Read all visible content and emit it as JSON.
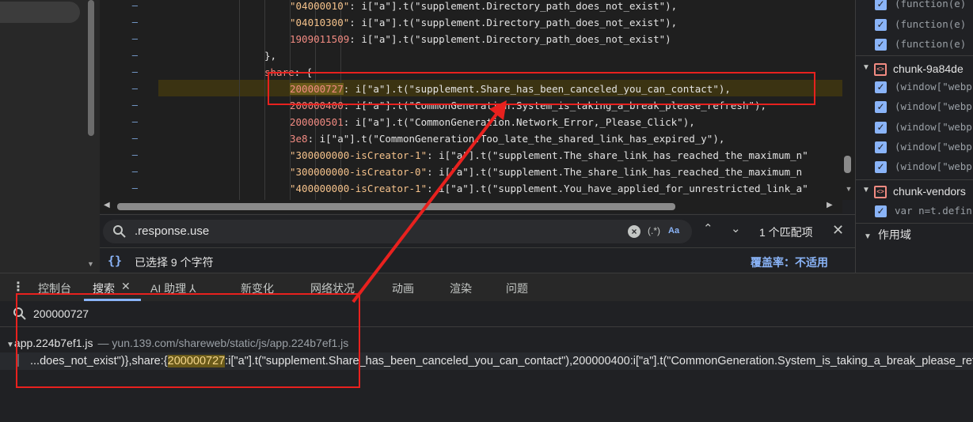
{
  "editor": {
    "lines": [
      {
        "k": "\"04000010\"",
        "v": ": i[\"a\"].t(\"supplement.Directory_path_does_not_exist\"),"
      },
      {
        "k": "\"04010300\"",
        "v": ": i[\"a\"].t(\"supplement.Directory_path_does_not_exist\"),"
      },
      {
        "k": "1909011509",
        "v": ": i[\"a\"].t(\"supplement.Directory_path_does_not_exist\")"
      },
      {
        "k": "",
        "v": "},"
      },
      {
        "k": "share",
        "v": ": {"
      },
      {
        "k": "200000727",
        "v": ": i[\"a\"].t(\"supplement.Share_has_been_canceled_you_can_contact\"),"
      },
      {
        "k": "200000400",
        "v": ": i[\"a\"].t(\"CommonGeneration.System_is_taking_a_break_please_refresh\"),"
      },
      {
        "k": "200000501",
        "v": ": i[\"a\"].t(\"CommonGeneration.Network_Error,_Please_Click\"),"
      },
      {
        "k": "3e8",
        "v": ": i[\"a\"].t(\"CommonGeneration.Too_late_the_shared_link_has_expired_y\"),"
      },
      {
        "k": "\"300000000-isCreator-1\"",
        "v": ": i[\"a\"].t(\"supplement.The_share_link_has_reached_the_maximum_n\""
      },
      {
        "k": "\"300000000-isCreator-0\"",
        "v": ": i[\"a\"].t(\"supplement.The_share_link_has_reached_the_maximum_n"
      },
      {
        "k": "\"400000000-isCreator-1\"",
        "v": ": i[\"a\"].t(\"supplement.You_have_applied_for_unrestricted_link_a\""
      }
    ],
    "gutter_mark": "–"
  },
  "findbar": {
    "query": ".response.use",
    "regex_label": "(.*)",
    "case_label": "Aa",
    "count": "1 个匹配项",
    "up": "⌃",
    "down": "⌄",
    "close": "✕"
  },
  "status": {
    "braces": "{}",
    "selected": "已选择 9 个字符",
    "coverage": "覆盖率：不适用"
  },
  "rightpane": {
    "group1_rows": [
      "(function(e)",
      "(function(e)",
      "(function(e)"
    ],
    "group2_name": "chunk-9a84de",
    "group2_rows": [
      "(window[\"webp",
      "(window[\"webp",
      "(window[\"webp",
      "(window[\"webp",
      "(window[\"webp"
    ],
    "group3_name": "chunk-vendors",
    "group3_rows": [
      "var n=t.defin"
    ],
    "scope": "作用域"
  },
  "drawer": {
    "tabs": [
      {
        "label": "控制台"
      },
      {
        "label": "搜索"
      },
      {
        "label": "AI 助理 ⅄"
      },
      {
        "label": "新变化"
      },
      {
        "label": "网络状况"
      },
      {
        "label": "动画"
      },
      {
        "label": "渲染"
      },
      {
        "label": "问题"
      }
    ],
    "close_glyph": "✕"
  },
  "search": {
    "query": "200000727",
    "result_file": "app.224b7ef1.js",
    "result_path": "— yun.139.com/shareweb/static/js/app.224b7ef1.js",
    "result_before": "...does_not_exist\")},share:{",
    "result_match": "200000727",
    "result_after": ":i[\"a\"].t(\"supplement.Share_has_been_canceled_you_can_contact\"),200000400:i[\"a\"].t(\"CommonGeneration.System_is_taking_a_break_please_refresh\")"
  },
  "colors": {
    "annotation_red": "#e8211e",
    "accent_blue": "#8ab4f8",
    "match_highlight": "#6a5a1a"
  }
}
